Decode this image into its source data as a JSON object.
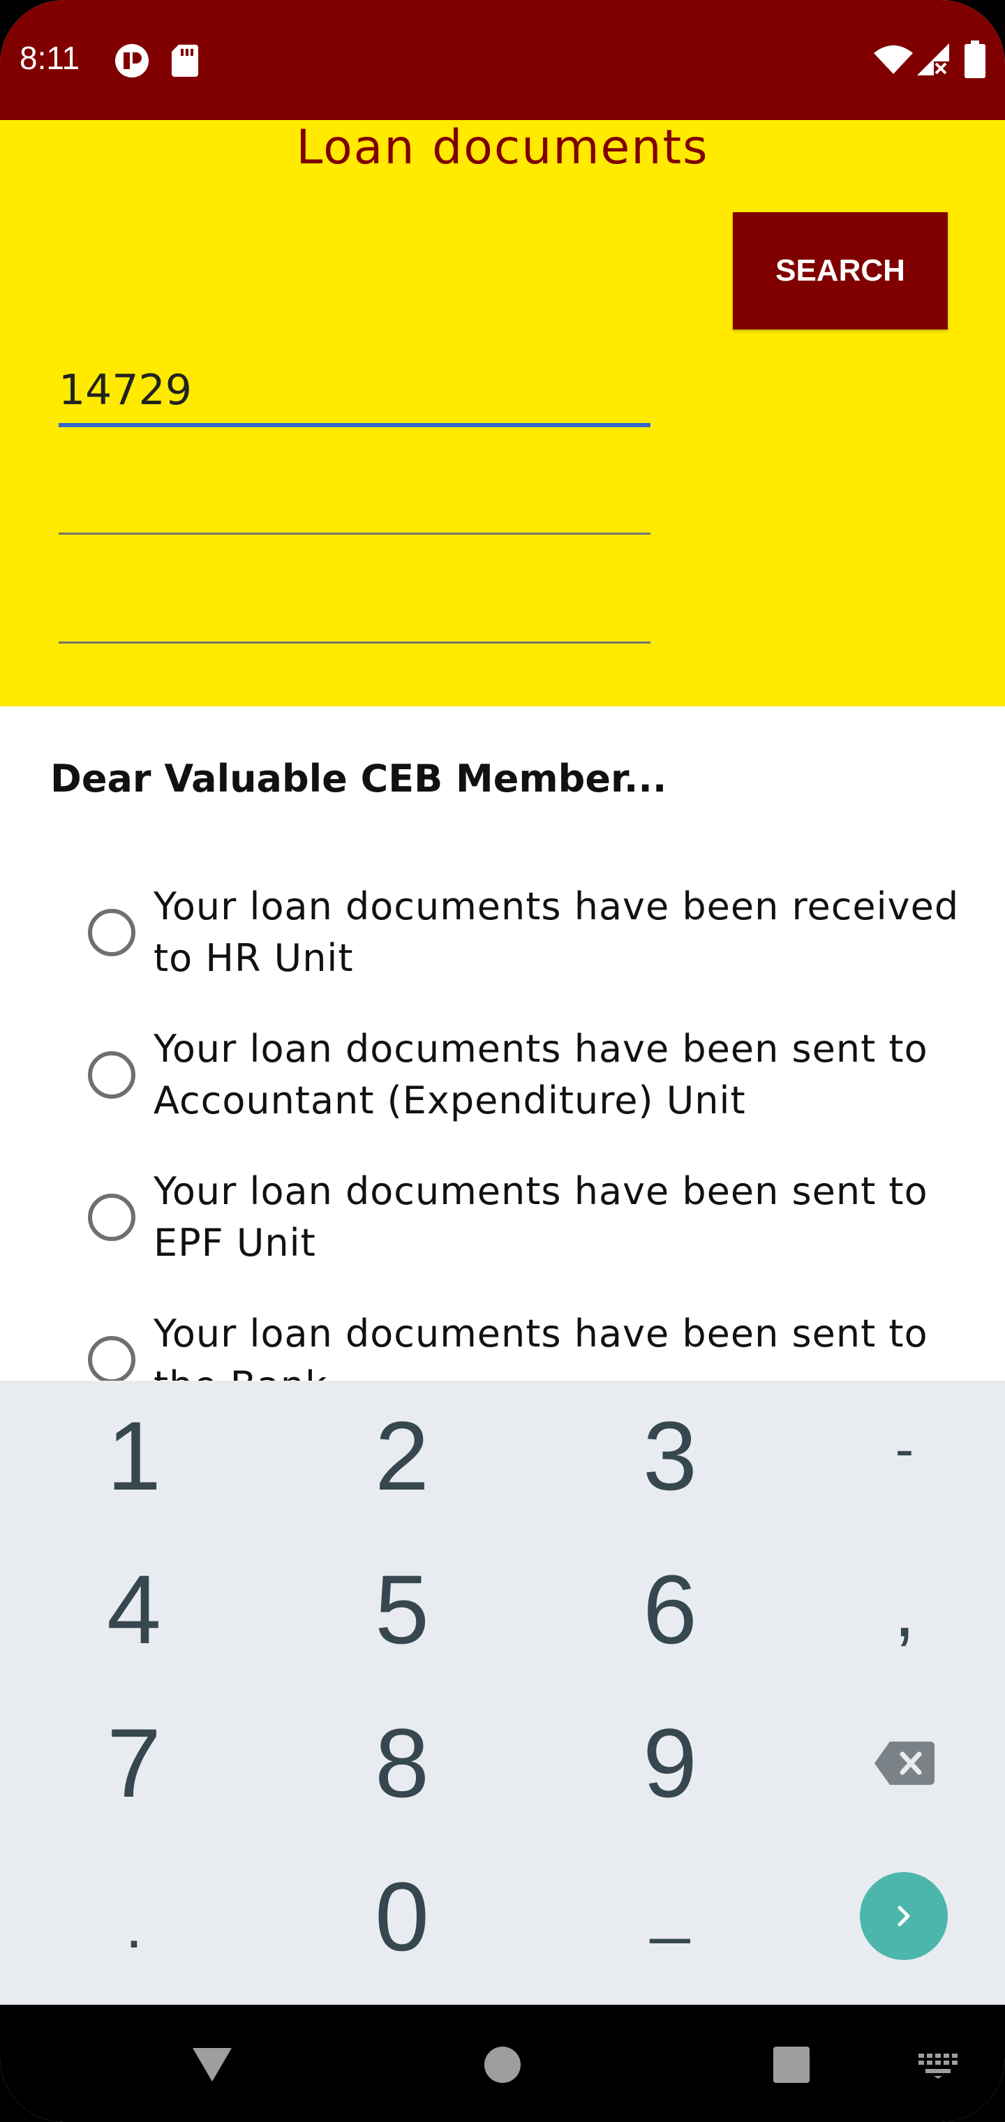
{
  "status_bar": {
    "time": "8:11",
    "icons": [
      "media-icon",
      "sd-card-icon",
      "wifi-icon",
      "signal-icon",
      "battery-icon"
    ]
  },
  "header": {
    "title": "Loan documents",
    "search_field_value": "14729",
    "search_button_label": "SEARCH"
  },
  "message": {
    "greeting": "Dear Valuable CEB Member...",
    "statuses": [
      "Your loan documents have been received to HR Unit",
      "Your loan documents have been sent to Accountant (Expenditure) Unit",
      "Your loan documents have been sent to EPF Unit",
      "Your loan documents have been sent to the Bank"
    ]
  },
  "keyboard": {
    "keys": [
      "1",
      "2",
      "3",
      "-",
      "4",
      "5",
      "6",
      ",",
      "7",
      "8",
      "9",
      "backspace",
      ".",
      "0",
      "_",
      "go"
    ]
  },
  "colors": {
    "primary": "#800000",
    "header_bg": "#ffea00",
    "accent_teal": "#4db6ac",
    "focus_blue": "#3366cc"
  }
}
